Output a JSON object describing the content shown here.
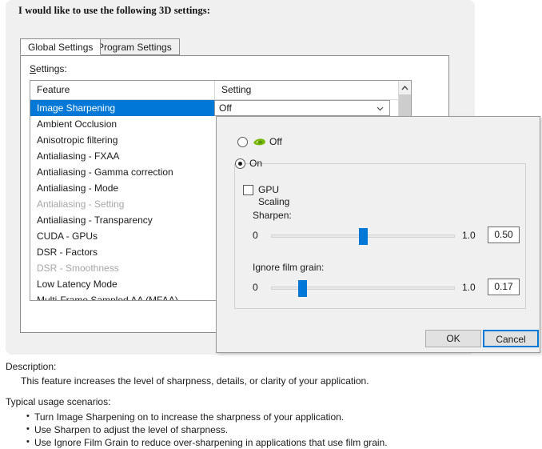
{
  "heading": "I would like to use the following 3D settings:",
  "tabs": [
    {
      "label": "Global Settings",
      "selected": true
    },
    {
      "label": "Program Settings",
      "selected": false
    }
  ],
  "settings_label": "Settings:",
  "grid": {
    "columns": [
      "Feature",
      "Setting"
    ],
    "rows": [
      {
        "feature": "Image Sharpening",
        "selected": true,
        "disabled": false,
        "setting": "Off"
      },
      {
        "feature": "Ambient Occlusion",
        "selected": false,
        "disabled": false
      },
      {
        "feature": "Anisotropic filtering",
        "selected": false,
        "disabled": false
      },
      {
        "feature": "Antialiasing - FXAA",
        "selected": false,
        "disabled": false
      },
      {
        "feature": "Antialiasing - Gamma correction",
        "selected": false,
        "disabled": false
      },
      {
        "feature": "Antialiasing - Mode",
        "selected": false,
        "disabled": false
      },
      {
        "feature": "Antialiasing - Setting",
        "selected": false,
        "disabled": true
      },
      {
        "feature": "Antialiasing - Transparency",
        "selected": false,
        "disabled": false
      },
      {
        "feature": "CUDA - GPUs",
        "selected": false,
        "disabled": false
      },
      {
        "feature": "DSR - Factors",
        "selected": false,
        "disabled": false
      },
      {
        "feature": "DSR - Smoothness",
        "selected": false,
        "disabled": true
      },
      {
        "feature": "Low Latency Mode",
        "selected": false,
        "disabled": false
      },
      {
        "feature": "Multi-Frame Sampled AA (MFAA)",
        "selected": false,
        "disabled": false
      }
    ],
    "selected_setting_value": "Off",
    "scrollbar": {
      "up_arrow": "scroll-up-arrow"
    }
  },
  "flyout": {
    "off_option": {
      "label": "Off",
      "checked": false,
      "icon": "nvidia-eye-logo"
    },
    "on_option": {
      "label": "On",
      "checked": true
    },
    "gpu_scaling": {
      "label": "GPU Scaling",
      "checked": false
    },
    "sharpen": {
      "caption": "Sharpen:",
      "min": "0",
      "max": "1.0",
      "value": "0.50",
      "percent": 50
    },
    "film_grain": {
      "caption": "Ignore film grain:",
      "min": "0",
      "max": "1.0",
      "value": "0.17",
      "percent": 17
    },
    "ok_label": "OK",
    "cancel_label": "Cancel"
  },
  "description": {
    "title": "Description:",
    "text": "This feature increases the level of sharpness, details, or clarity of your application.",
    "usage_title": "Typical usage scenarios:",
    "usage_items": [
      "Turn Image Sharpening on to increase the sharpness of your application.",
      "Use Sharpen to adjust the level of sharpness.",
      "Use Ignore Film Grain to reduce over-sharpening in applications that use film grain."
    ]
  },
  "colors": {
    "accent": "#0078d7",
    "panel": "#f0f0f0",
    "nvidia_green": "#76b900"
  }
}
